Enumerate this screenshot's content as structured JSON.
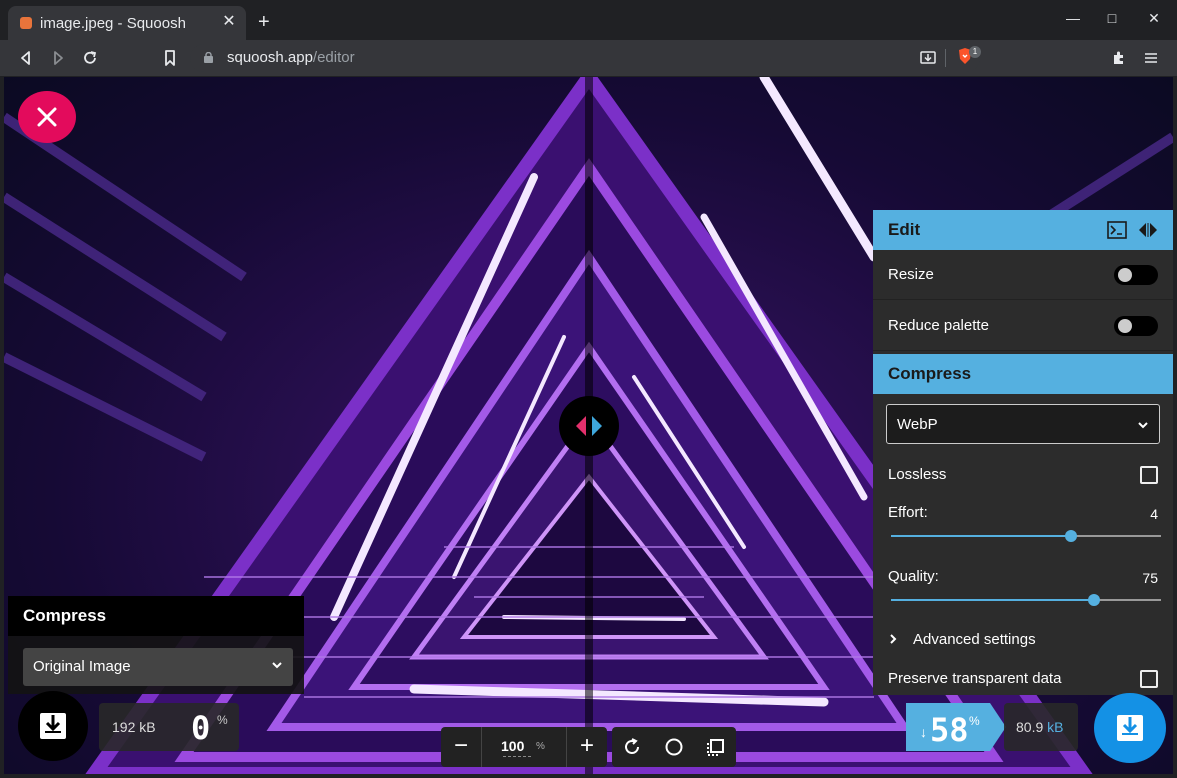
{
  "browser": {
    "tab_title": "image.jpeg - Squoosh",
    "new_tab_label": "+",
    "url_host": "squoosh.app",
    "url_path": "/editor",
    "brave_badge_count": "1",
    "window_controls": {
      "minimize": "—",
      "maximize": "□",
      "close": "✕"
    }
  },
  "editor": {
    "left": {
      "section_title": "Compress",
      "codec": "Original Image",
      "size": "192 kB",
      "percent": "0",
      "percent_unit": "%"
    },
    "zoom": {
      "minus": "−",
      "value": "100",
      "unit": "%",
      "plus": "+"
    },
    "right": {
      "edit_title": "Edit",
      "resize_label": "Resize",
      "resize_enabled": false,
      "reduce_palette_label": "Reduce palette",
      "reduce_palette_enabled": false,
      "compress_title": "Compress",
      "codec": "WebP",
      "lossless_label": "Lossless",
      "lossless_checked": false,
      "effort_label": "Effort:",
      "effort_value": "4",
      "effort_min": 0,
      "effort_max": 6,
      "quality_label": "Quality:",
      "quality_value": "75",
      "quality_min": 0,
      "quality_max": 100,
      "advanced_label": "Advanced settings",
      "preserve_label": "Preserve transparent data",
      "preserve_checked": false,
      "saving_arrow": "↓",
      "saving_percent": "58",
      "saving_unit": "%",
      "size_value": "80.9",
      "size_unit": "kB"
    },
    "colors": {
      "accent_blue": "#55b0e0",
      "close_pink": "#e30b5c",
      "download_blue": "#1491e5"
    }
  }
}
